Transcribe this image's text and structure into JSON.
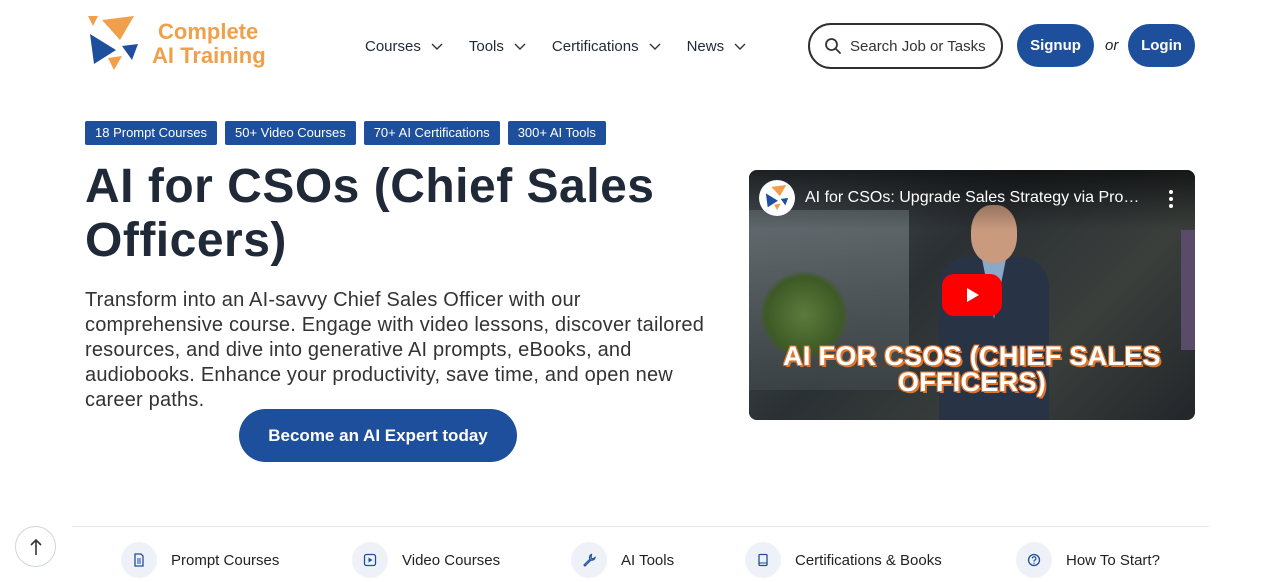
{
  "logo": {
    "line1": "Complete",
    "line2": "AI Training"
  },
  "nav": {
    "items": [
      {
        "label": "Courses"
      },
      {
        "label": "Tools"
      },
      {
        "label": "Certifications"
      },
      {
        "label": "News"
      }
    ]
  },
  "search": {
    "placeholder": "Search Job or Tasks"
  },
  "auth": {
    "signup": "Signup",
    "or": "or",
    "login": "Login"
  },
  "badges": [
    "18 Prompt Courses",
    "50+ Video Courses",
    "70+ AI Certifications",
    "300+ AI Tools"
  ],
  "hero": {
    "title": "AI for CSOs (Chief Sales Officers)",
    "description": "Transform into an AI-savvy Chief Sales Officer with our comprehensive course. Engage with video lessons, discover tailored resources, and dive into generative AI prompts, eBooks, and audiobooks. Enhance your productivity, save time, and open new career paths.",
    "cta": "Become an AI Expert today"
  },
  "video": {
    "title": "AI for CSOs: Upgrade Sales Strategy via Prom...",
    "overlay_line1": "AI FOR CSOS (CHIEF SALES",
    "overlay_line2": "OFFICERS)",
    "channel_logo_text": "Complete AI Training"
  },
  "footer_tabs": [
    {
      "label": "Prompt Courses",
      "icon": "document-icon"
    },
    {
      "label": "Video Courses",
      "icon": "play-square-icon"
    },
    {
      "label": "AI Tools",
      "icon": "wrench-icon"
    },
    {
      "label": "Certifications & Books",
      "icon": "book-icon"
    },
    {
      "label": "How To Start?",
      "icon": "question-circle-icon"
    }
  ],
  "colors": {
    "brand_blue": "#1e4f9c",
    "logo_orange": "#f0a04b",
    "youtube_red": "#ff0000"
  }
}
